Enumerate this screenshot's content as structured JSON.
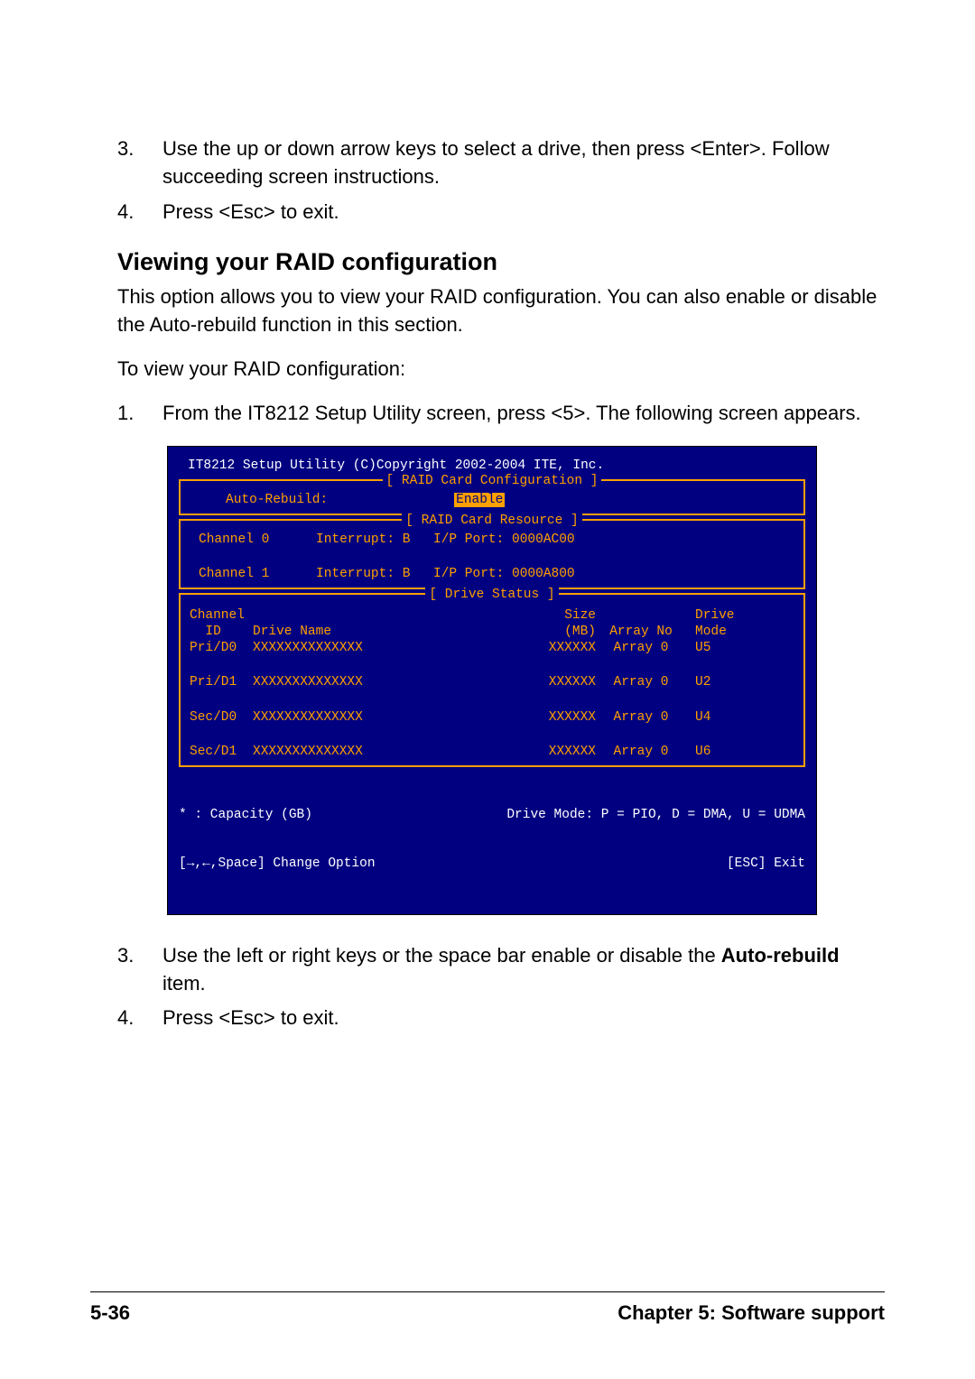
{
  "pre_steps": [
    {
      "num": "3.",
      "text": "Use the up or down arrow keys to select a drive, then press <Enter>. Follow succeeding screen instructions."
    },
    {
      "num": "4.",
      "text": "Press <Esc> to exit."
    }
  ],
  "heading": "Viewing your RAID configuration",
  "para1": "This option allows you to view your RAID configuration. You can also enable or disable the Auto-rebuild function in this section.",
  "para2": "To view your RAID configuration:",
  "mid_steps": [
    {
      "num": "1.",
      "text": "From the IT8212 Setup Utility screen, press <5>. The following screen appears."
    }
  ],
  "terminal": {
    "title": "IT8212 Setup Utility (C)Copyright 2002-2004 ITE, Inc.",
    "box1": {
      "title": "[ RAID Card Configuration ]",
      "label": "Auto-Rebuild:",
      "value": "Enable"
    },
    "box2": {
      "title": "[ RAID Card Resource ]",
      "rows": [
        {
          "ch": "Channel 0",
          "int": "Interrupt: B",
          "port": "I/P Port: 0000AC00"
        },
        {
          "ch": "Channel 1",
          "int": "Interrupt: B",
          "port": "I/P Port: 0000A800"
        }
      ]
    },
    "box3": {
      "title": "[ Drive Status ]",
      "hdr1": {
        "c1": "Channel",
        "c4": "Size",
        "c6": "Drive"
      },
      "hdr2": {
        "c1": "  ID",
        "c2": "Drive Name",
        "c4": "(MB)",
        "c5": "Array No",
        "c6": "Mode"
      },
      "rows": [
        {
          "id": "Pri/D0",
          "name": "XXXXXXXXXXXXXX",
          "size": "XXXXXX",
          "arr": "Array 0",
          "mode": "U5"
        },
        {
          "id": "Pri/D1",
          "name": "XXXXXXXXXXXXXX",
          "size": "XXXXXX",
          "arr": "Array 0",
          "mode": "U2"
        },
        {
          "id": "Sec/D0",
          "name": "XXXXXXXXXXXXXX",
          "size": "XXXXXX",
          "arr": "Array 0",
          "mode": "U4"
        },
        {
          "id": "Sec/D1",
          "name": "XXXXXXXXXXXXXX",
          "size": "XXXXXX",
          "arr": "Array 0",
          "mode": "U6"
        }
      ]
    },
    "footer": {
      "l1": "* : Capacity (GB)",
      "r1": "Drive Mode: P = PIO, D = DMA, U = UDMA",
      "l2": "[→,←,Space] Change Option",
      "r2": "[ESC] Exit"
    }
  },
  "post_steps": [
    {
      "num": "3.",
      "pre": "Use the left or right keys or the space bar enable or disable the ",
      "bold": "Auto-rebuild",
      "post": " item."
    },
    {
      "num": "4.",
      "text": "Press <Esc> to exit."
    }
  ],
  "page_footer": {
    "left": "5-36",
    "right": "Chapter 5: Software support"
  }
}
